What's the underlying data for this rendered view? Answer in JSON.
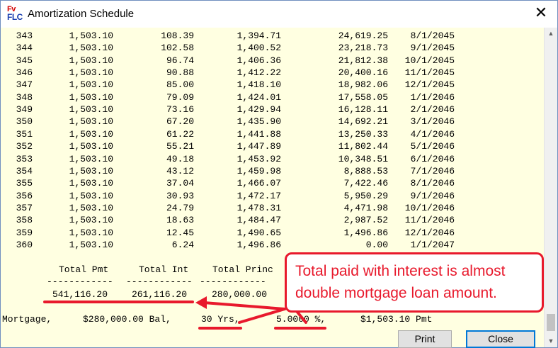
{
  "window": {
    "title": "Amortization Schedule",
    "app_icon_top": "Fv",
    "app_icon_bottom": "FLC",
    "close_glyph": "✕"
  },
  "schedule": {
    "rows": [
      [
        "343",
        "1,503.10",
        "108.39",
        "1,394.71",
        "24,619.25",
        "8/1/2045"
      ],
      [
        "344",
        "1,503.10",
        "102.58",
        "1,400.52",
        "23,218.73",
        "9/1/2045"
      ],
      [
        "345",
        "1,503.10",
        "96.74",
        "1,406.36",
        "21,812.38",
        "10/1/2045"
      ],
      [
        "346",
        "1,503.10",
        "90.88",
        "1,412.22",
        "20,400.16",
        "11/1/2045"
      ],
      [
        "347",
        "1,503.10",
        "85.00",
        "1,418.10",
        "18,982.06",
        "12/1/2045"
      ],
      [
        "348",
        "1,503.10",
        "79.09",
        "1,424.01",
        "17,558.05",
        "1/1/2046"
      ],
      [
        "349",
        "1,503.10",
        "73.16",
        "1,429.94",
        "16,128.11",
        "2/1/2046"
      ],
      [
        "350",
        "1,503.10",
        "67.20",
        "1,435.90",
        "14,692.21",
        "3/1/2046"
      ],
      [
        "351",
        "1,503.10",
        "61.22",
        "1,441.88",
        "13,250.33",
        "4/1/2046"
      ],
      [
        "352",
        "1,503.10",
        "55.21",
        "1,447.89",
        "11,802.44",
        "5/1/2046"
      ],
      [
        "353",
        "1,503.10",
        "49.18",
        "1,453.92",
        "10,348.51",
        "6/1/2046"
      ],
      [
        "354",
        "1,503.10",
        "43.12",
        "1,459.98",
        "8,888.53",
        "7/1/2046"
      ],
      [
        "355",
        "1,503.10",
        "37.04",
        "1,466.07",
        "7,422.46",
        "8/1/2046"
      ],
      [
        "356",
        "1,503.10",
        "30.93",
        "1,472.17",
        "5,950.29",
        "9/1/2046"
      ],
      [
        "357",
        "1,503.10",
        "24.79",
        "1,478.31",
        "4,471.98",
        "10/1/2046"
      ],
      [
        "358",
        "1,503.10",
        "18.63",
        "1,484.47",
        "2,987.52",
        "11/1/2046"
      ],
      [
        "359",
        "1,503.10",
        "12.45",
        "1,490.65",
        "1,496.86",
        "12/1/2046"
      ],
      [
        "360",
        "1,503.10",
        "6.24",
        "1,496.86",
        "0.00",
        "1/1/2047"
      ]
    ]
  },
  "totals": {
    "pmt_label": "Total Pmt",
    "int_label": "Total Int",
    "princ_label": "Total Princ",
    "rule": "------------",
    "pmt_value": "541,116.20",
    "int_value": "261,116.20",
    "princ_value": "280,000.00"
  },
  "summary": {
    "mortgage_label": "Mortgage,",
    "balance": "$280,000.00 Bal,",
    "term": "30 Yrs,",
    "rate": "5.0000 %,",
    "payment": "$1,503.10 Pmt"
  },
  "buttons": {
    "print": "Print",
    "close": "Close"
  },
  "annotation": {
    "line1": "Total paid with interest is almost",
    "line2": "double mortgage loan amount.",
    "color": "#e8192c"
  }
}
